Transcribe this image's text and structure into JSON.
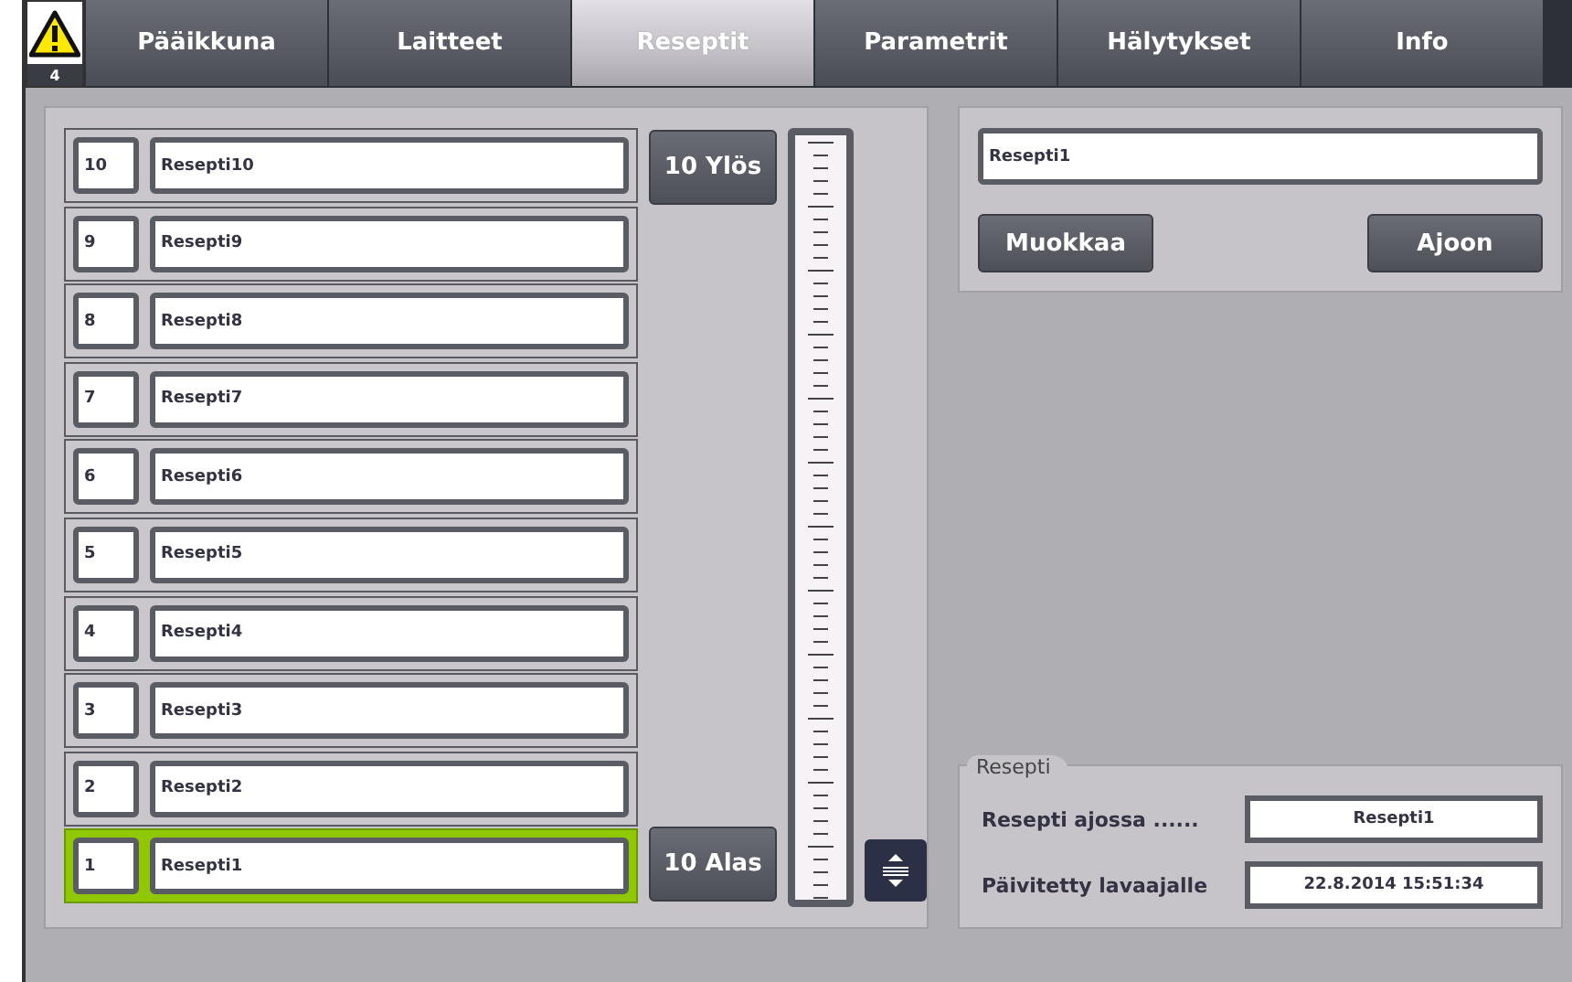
{
  "alarm": {
    "count": "4"
  },
  "tabs": [
    {
      "label": "Pääikkuna",
      "selected": false
    },
    {
      "label": "Laitteet",
      "selected": false
    },
    {
      "label": "Reseptit",
      "selected": true
    },
    {
      "label": "Parametrit",
      "selected": false
    },
    {
      "label": "Hälytykset",
      "selected": false
    },
    {
      "label": "Info",
      "selected": false
    }
  ],
  "recipes": [
    {
      "number": "10",
      "name": "Resepti10",
      "selected": false
    },
    {
      "number": "9",
      "name": "Resepti9",
      "selected": false
    },
    {
      "number": "8",
      "name": "Resepti8",
      "selected": false
    },
    {
      "number": "7",
      "name": "Resepti7",
      "selected": false
    },
    {
      "number": "6",
      "name": "Resepti6",
      "selected": false
    },
    {
      "number": "5",
      "name": "Resepti5",
      "selected": false
    },
    {
      "number": "4",
      "name": "Resepti4",
      "selected": false
    },
    {
      "number": "3",
      "name": "Resepti3",
      "selected": false
    },
    {
      "number": "2",
      "name": "Resepti2",
      "selected": false
    },
    {
      "number": "1",
      "name": "Resepti1",
      "selected": true
    }
  ],
  "scroll_buttons": {
    "up": "10 Ylös",
    "down": "10 Alas"
  },
  "editor": {
    "name": "Resepti1",
    "buttons": [
      "Muokkaa",
      "Ajoon"
    ]
  },
  "status": {
    "title": "Resepti",
    "rows": [
      {
        "label": "Resepti ajossa ......",
        "value": "Resepti1"
      },
      {
        "label": "Päivitetty lavaajalle",
        "value": "22.8.2014 15:51:34"
      }
    ]
  }
}
